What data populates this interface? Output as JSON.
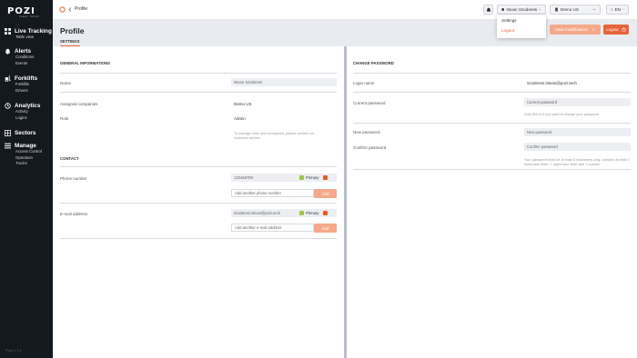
{
  "sidebar": {
    "logo": "POZI",
    "logo_sub": "FLEET TRACK",
    "groups": [
      {
        "label": "Live Tracking",
        "subs": [
          "Table view"
        ]
      },
      {
        "label": "Alerts",
        "subs": [
          "Conditions",
          "Events"
        ]
      },
      {
        "label": "Forklifts",
        "subs": [
          "Forklifts",
          "Drivers"
        ]
      },
      {
        "label": "Analytics",
        "subs": [
          "Activity",
          "Logins"
        ]
      },
      {
        "label": "Sectors",
        "subs": []
      },
      {
        "label": "Manage",
        "subs": [
          "Access Control",
          "Operators",
          "Trucks"
        ]
      }
    ],
    "version": "Pozi 1.7.1"
  },
  "topbar": {
    "breadcrumb": "Profile",
    "user": "Istvan Szoderesi",
    "company": "Demo US",
    "language": "EN"
  },
  "user_menu": {
    "items": [
      "Settings",
      "Logout"
    ]
  },
  "header": {
    "title": "Profile",
    "tab": "SETTINGS",
    "save_label": "Save modifications",
    "logout_label": "Logout"
  },
  "general": {
    "title": "GENERAL INFORMATIONS",
    "name_label": "Name",
    "name_value": "Istvan Szoderesi",
    "companies_label": "Assigned companies",
    "companies_value": "Demo US",
    "role_label": "Role",
    "role_value": "Admin",
    "hint": "To manage roles and companies, please contact our customer service."
  },
  "contact": {
    "title": "CONTACT",
    "phone_label": "Phone number",
    "phone_value": "123456789",
    "primary_label": "Primary",
    "add_phone_placeholder": "Add another phone number",
    "add_label": "Add",
    "email_label": "E-mail address",
    "email_value": "szoderesi.istvan@pozi.tech",
    "add_email_placeholder": "Add another e-mail address"
  },
  "password": {
    "title": "CHANGE PASSWORD",
    "login_label": "Login name",
    "login_value": "szoderesi.istvan@pozi.tech",
    "current_label": "Current password",
    "current_placeholder": "Current password",
    "current_hint": "Only fill it in if you want to change your password",
    "new_label": "New password",
    "new_placeholder": "New password",
    "confirm_label": "Confirm password",
    "confirm_placeholder": "Confirm password",
    "rules_hint": "Your password must be at least 8 characters long, contains at least 1 lowercase letter, 1 uppercase letter and 1 number"
  },
  "colors": {
    "accent": "#e8623a",
    "accent_light": "#f4a98a",
    "sidebar": "#14181f",
    "primary_check": "#9ec44a"
  }
}
